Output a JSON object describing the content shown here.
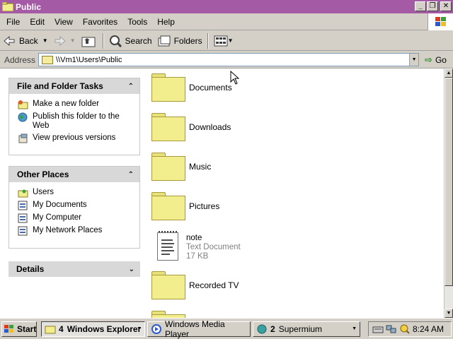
{
  "window": {
    "title": "Public"
  },
  "menu": {
    "items": [
      "File",
      "Edit",
      "View",
      "Favorites",
      "Tools",
      "Help"
    ]
  },
  "toolbar": {
    "back_label": "Back",
    "search_label": "Search",
    "folders_label": "Folders"
  },
  "address": {
    "label": "Address",
    "value": "\\\\Vm1\\Users\\Public",
    "go_label": "Go"
  },
  "tasks": {
    "file_tasks": {
      "title": "File and Folder Tasks",
      "items": [
        "Make a new folder",
        "Publish this folder to the Web",
        "View previous versions"
      ]
    },
    "other_places": {
      "title": "Other Places",
      "items": [
        "Users",
        "My Documents",
        "My Computer",
        "My Network Places"
      ]
    },
    "details": {
      "title": "Details"
    }
  },
  "files": [
    {
      "name": "Documents",
      "type": "folder"
    },
    {
      "name": "Downloads",
      "type": "folder"
    },
    {
      "name": "Music",
      "type": "folder"
    },
    {
      "name": "Pictures",
      "type": "folder"
    },
    {
      "name": "note",
      "type": "document",
      "subtitle": "Text Document",
      "size": "17 KB"
    },
    {
      "name": "Recorded TV",
      "type": "folder"
    }
  ],
  "taskbar": {
    "start_label": "Start",
    "group1": {
      "count": "4",
      "label": "Windows Explorer"
    },
    "group2": {
      "label": "Windows Media Player"
    },
    "group3": {
      "count": "2",
      "label": "Supermium"
    },
    "clock": "8:24 AM"
  },
  "colors": {
    "titlebar": "#a45aa4",
    "folder": "#f2ee8e",
    "pane_header": "#d8d8d8"
  }
}
